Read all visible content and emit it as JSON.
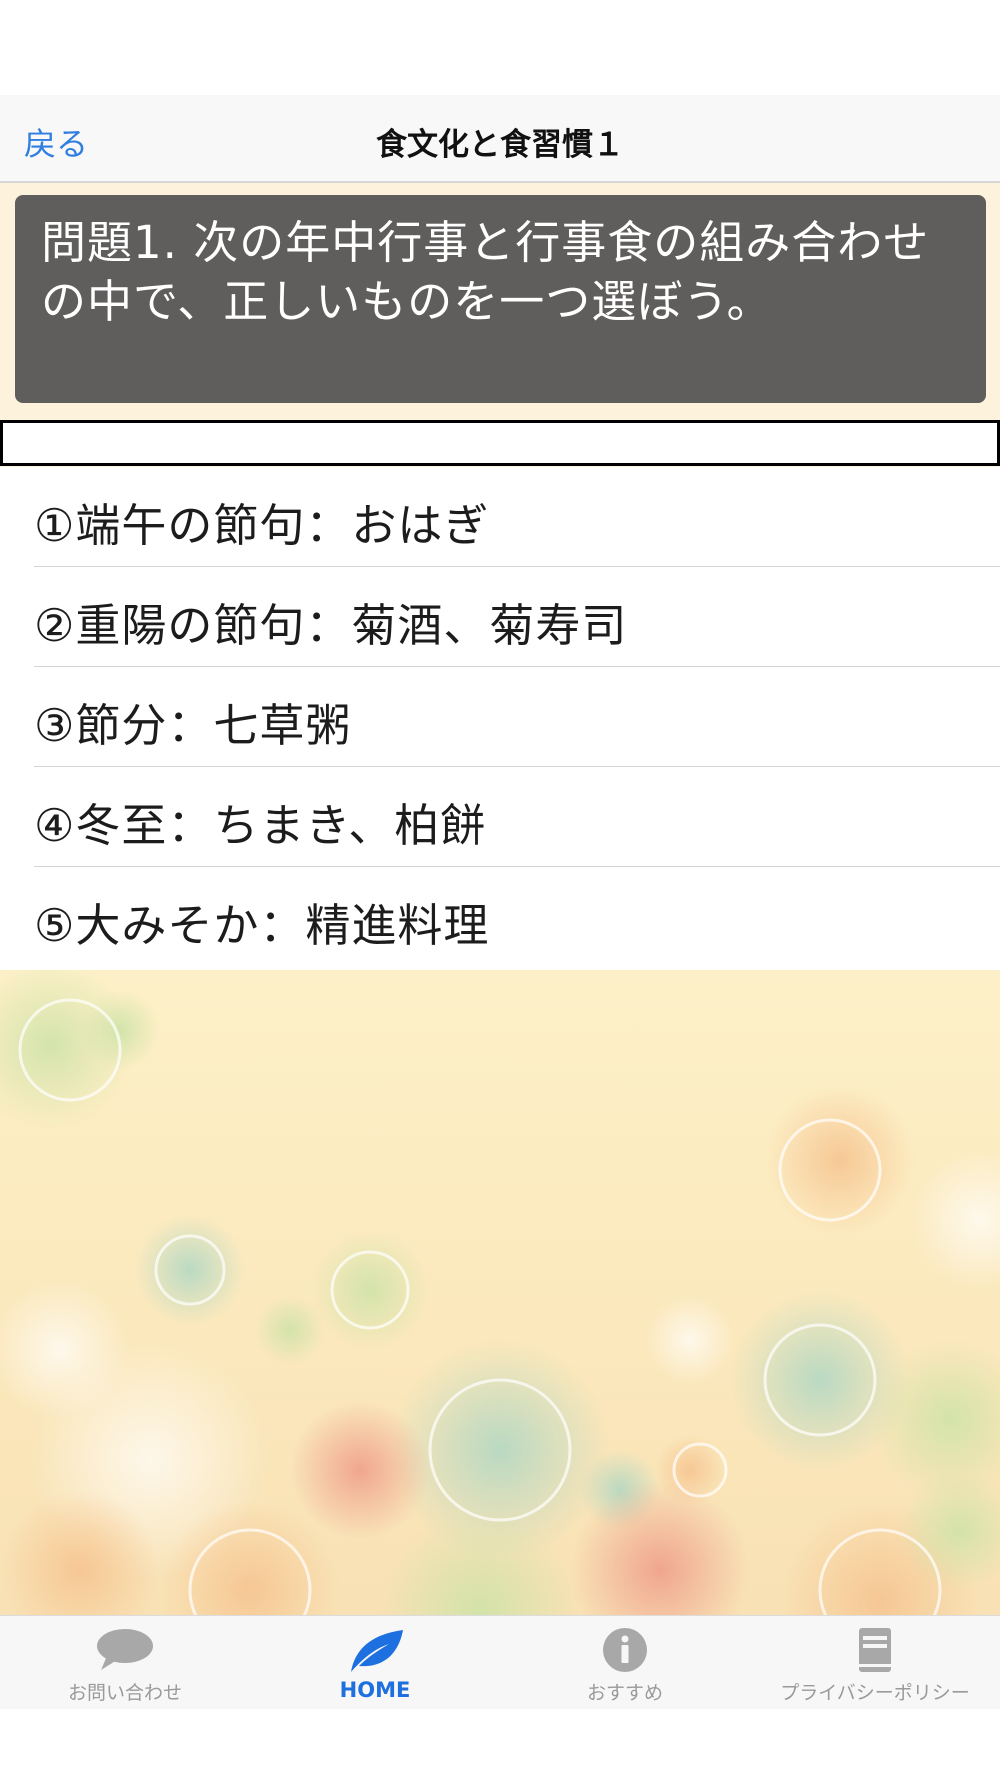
{
  "nav": {
    "back_label": "戻る",
    "title": "食文化と食習慣１"
  },
  "question": {
    "text": "問題1. 次の年中行事と行事食の組み合わせの中で、正しいものを一つ選ぼう。"
  },
  "choices": [
    {
      "label": "①端午の節句：おはぎ"
    },
    {
      "label": "②重陽の節句：菊酒、菊寿司"
    },
    {
      "label": "③節分：七草粥"
    },
    {
      "label": "④冬至：ちまき、柏餅"
    },
    {
      "label": "⑤大みそか：精進料理"
    }
  ],
  "tabbar": {
    "items": [
      {
        "label": "お問い合わせ",
        "icon": "chat-bubble-icon"
      },
      {
        "label": "HOME",
        "icon": "leaf-icon",
        "active": true
      },
      {
        "label": "おすすめ",
        "icon": "info-icon"
      },
      {
        "label": "プライバシーポリシー",
        "icon": "book-icon"
      }
    ]
  },
  "colors": {
    "accent": "#1e6fe0",
    "back_link": "#2f7ee0",
    "question_bg": "#5f5e5c",
    "background": "#fdf3dc"
  }
}
